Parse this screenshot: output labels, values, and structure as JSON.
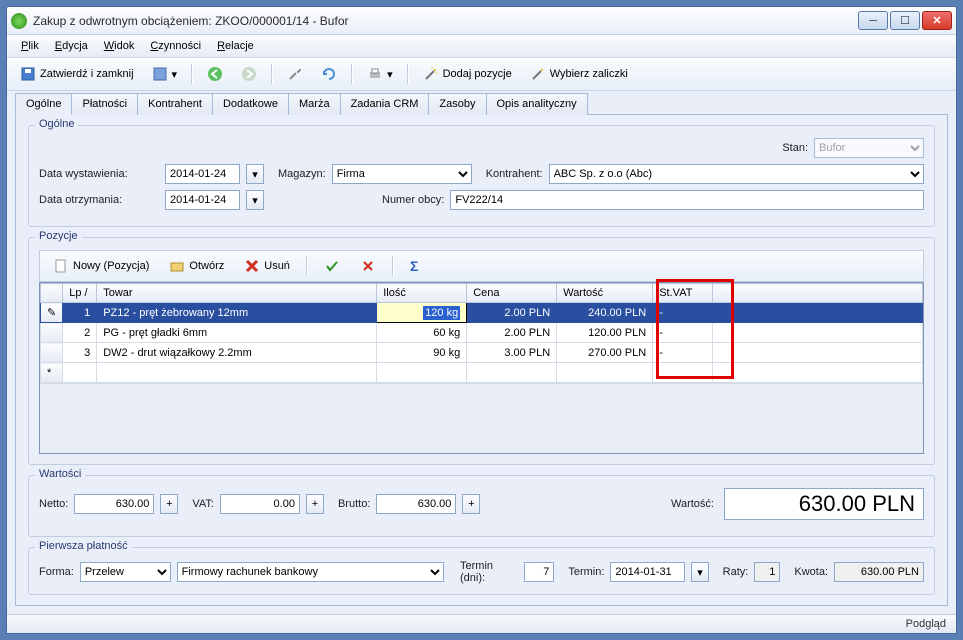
{
  "window": {
    "title": "Zakup z odwrotnym obciążeniem: ZKOO/000001/14 - Bufor"
  },
  "menu": {
    "plik": "Plik",
    "edycja": "Edycja",
    "widok": "Widok",
    "czynnosci": "Czynności",
    "relacje": "Relacje"
  },
  "toolbar": {
    "zatwierdz": "Zatwierdź i zamknij",
    "dodaj_pozycje": "Dodaj pozycje",
    "wybierz_zaliczki": "Wybierz zaliczki"
  },
  "tabs": [
    "Ogólne",
    "Płatności",
    "Kontrahent",
    "Dodatkowe",
    "Marża",
    "Zadania CRM",
    "Zasoby",
    "Opis analityczny"
  ],
  "ogolne": {
    "title": "Ogólne",
    "stan_label": "Stan:",
    "stan_value": "Bufor",
    "data_wyst_label": "Data wystawienia:",
    "data_wyst": "2014-01-24",
    "magazyn_label": "Magazyn:",
    "magazyn": "Firma",
    "kontrahent_label": "Kontrahent:",
    "kontrahent": "ABC Sp. z o.o (Abc)",
    "data_otrz_label": "Data otrzymania:",
    "data_otrz": "2014-01-24",
    "numer_obcy_label": "Numer obcy:",
    "numer_obcy": "FV222/14"
  },
  "pozycje": {
    "title": "Pozycje",
    "nowy": "Nowy (Pozycja)",
    "otworz": "Otwórz",
    "usun": "Usuń",
    "cols": {
      "lp": "Lp",
      "towar": "Towar",
      "ilosc": "Ilość",
      "cena": "Cena",
      "wartosc": "Wartość",
      "stvat": "St.VAT"
    },
    "rows": [
      {
        "lp": "1",
        "towar": "PZ12 - pręt żebrowany 12mm",
        "ilosc": "120 kg",
        "cena": "2.00 PLN",
        "wartosc": "240.00 PLN",
        "stvat": "-"
      },
      {
        "lp": "2",
        "towar": "PG - pręt gładki 6mm",
        "ilosc": "60 kg",
        "cena": "2.00 PLN",
        "wartosc": "120.00 PLN",
        "stvat": "-"
      },
      {
        "lp": "3",
        "towar": "DW2 - drut wiązałkowy 2.2mm",
        "ilosc": "90 kg",
        "cena": "3.00 PLN",
        "wartosc": "270.00 PLN",
        "stvat": "-"
      }
    ]
  },
  "wartosci": {
    "title": "Wartości",
    "netto_label": "Netto:",
    "netto": "630.00",
    "vat_label": "VAT:",
    "vat": "0.00",
    "brutto_label": "Brutto:",
    "brutto": "630.00",
    "wartosc_label": "Wartość:",
    "wartosc": "630.00 PLN"
  },
  "platnosc": {
    "title": "Pierwsza płatność",
    "forma_label": "Forma:",
    "forma": "Przelew",
    "rachunek": "Firmowy rachunek bankowy",
    "termin_dni_label": "Termin (dni):",
    "termin_dni": "7",
    "termin_label": "Termin:",
    "termin": "2014-01-31",
    "raty_label": "Raty:",
    "raty": "1",
    "kwota_label": "Kwota:",
    "kwota": "630.00 PLN"
  },
  "footer": {
    "podglad": "Podgląd"
  }
}
